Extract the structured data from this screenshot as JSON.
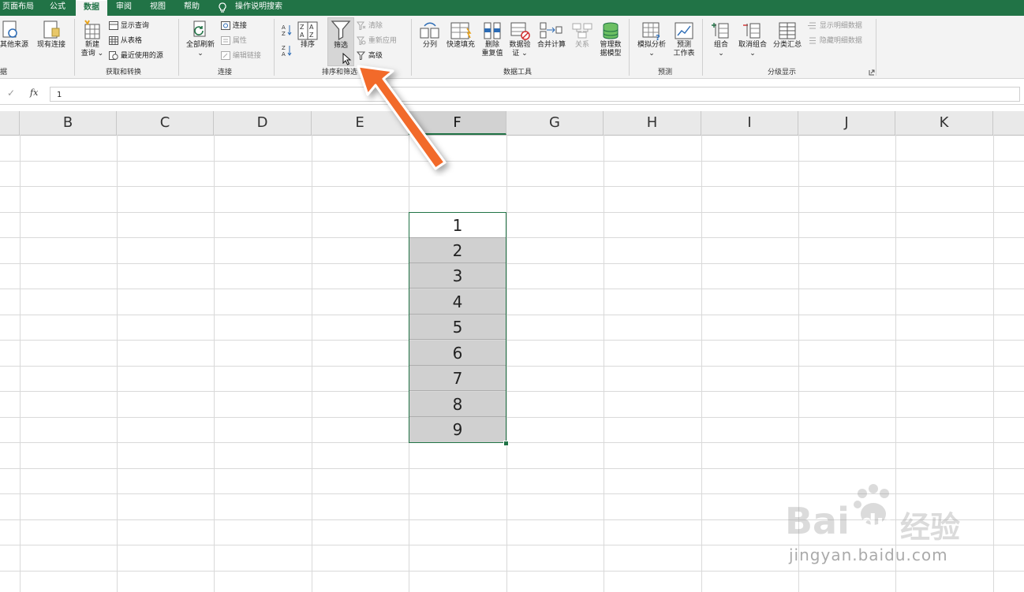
{
  "tabs": [
    {
      "label": "页面布局",
      "active": false
    },
    {
      "label": "公式",
      "active": false
    },
    {
      "label": "数据",
      "active": true
    },
    {
      "label": "审阅",
      "active": false
    },
    {
      "label": "视图",
      "active": false
    },
    {
      "label": "帮助",
      "active": false
    },
    {
      "label": "操作说明搜索",
      "active": false
    }
  ],
  "ribbon": {
    "groups": {
      "get_partial": "据",
      "get_transform": "获取和转换",
      "connections": "连接",
      "sort_filter": "排序和筛选",
      "data_tools": "数据工具",
      "forecast": "预测",
      "outline": "分级显示"
    },
    "buttons": {
      "other_sources": "其他来源",
      "existing_conn": "现有连接",
      "new_query_1": "新建",
      "new_query_2": "查询 ⌄",
      "show_query": "显示查询",
      "from_table": "从表格",
      "recent_sources": "最近使用的源",
      "refresh_all": "全部刷新",
      "connections": "连接",
      "properties": "属性",
      "edit_links": "编辑链接",
      "sort": "排序",
      "filter": "筛选",
      "clear": "清除",
      "reapply": "重新应用",
      "advanced": "高级",
      "text_to_columns": "分列",
      "flash_fill": "快速填充",
      "remove_dup_1": "删除",
      "remove_dup_2": "重复值",
      "data_validation_1": "数据验",
      "data_validation_2": "证 ⌄",
      "consolidate": "合并计算",
      "relationships": "关系",
      "manage_model_1": "管理数",
      "manage_model_2": "据模型",
      "whatif": "模拟分析",
      "forecast_sheet_1": "预测",
      "forecast_sheet_2": "工作表",
      "group": "组合",
      "ungroup": "取消组合",
      "subtotal": "分类汇总",
      "show_detail": "显示明细数据",
      "hide_detail": "隐藏明细数据"
    }
  },
  "formula_bar": {
    "fx": "fx",
    "value": "1"
  },
  "columns": [
    "B",
    "C",
    "D",
    "E",
    "F",
    "G",
    "H",
    "I",
    "J",
    "K"
  ],
  "selected_column": "F",
  "cells_F": [
    "1",
    "2",
    "3",
    "4",
    "5",
    "6",
    "7",
    "8",
    "9"
  ],
  "watermark": {
    "brand": "Bai",
    "brand2": "du",
    "cn": "经验",
    "url": "jingyan.baidu.com"
  },
  "colors": {
    "excel_green": "#217346",
    "arrow_orange": "#f26a2c",
    "selection_fill": "#d0d0d0"
  }
}
